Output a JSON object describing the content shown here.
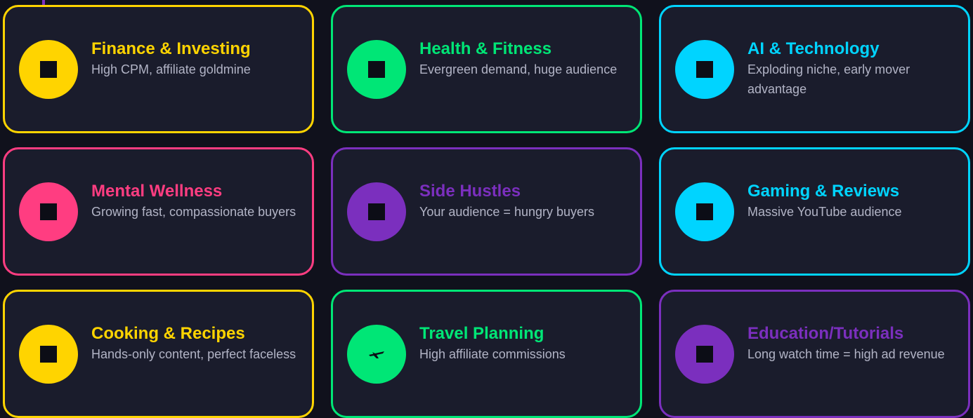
{
  "colors": {
    "background": "#10111c",
    "card": "#1a1c2c",
    "yellow": "#ffd400",
    "green": "#00e676",
    "cyan": "#00d4ff",
    "pink": "#ff3d81",
    "purple": "#7b2fbe",
    "description": "#b2b4c6"
  },
  "niches": [
    {
      "title": "Finance & Investing",
      "description": "High CPM, affiliate goldmine",
      "color": "#ffd400",
      "icon": "square-icon"
    },
    {
      "title": "Health & Fitness",
      "description": "Evergreen demand, huge audience",
      "color": "#00e676",
      "icon": "square-icon"
    },
    {
      "title": "AI & Technology",
      "description": "Exploding niche, early mover advantage",
      "color": "#00d4ff",
      "icon": "square-icon"
    },
    {
      "title": "Mental Wellness",
      "description": "Growing fast, compassionate buyers",
      "color": "#ff3d81",
      "icon": "square-icon"
    },
    {
      "title": "Side Hustles",
      "description": "Your audience = hungry buyers",
      "color": "#7b2fbe",
      "icon": "square-icon"
    },
    {
      "title": "Gaming & Reviews",
      "description": "Massive YouTube audience",
      "color": "#00d4ff",
      "icon": "square-icon"
    },
    {
      "title": "Cooking & Recipes",
      "description": "Hands-only content, perfect faceless",
      "color": "#ffd400",
      "icon": "square-icon"
    },
    {
      "title": "Travel Planning",
      "description": "High affiliate commissions",
      "color": "#00e676",
      "icon": "airplane-icon"
    },
    {
      "title": "Education/Tutorials",
      "description": "Long watch time = high ad revenue",
      "color": "#7b2fbe",
      "icon": "square-icon"
    }
  ]
}
